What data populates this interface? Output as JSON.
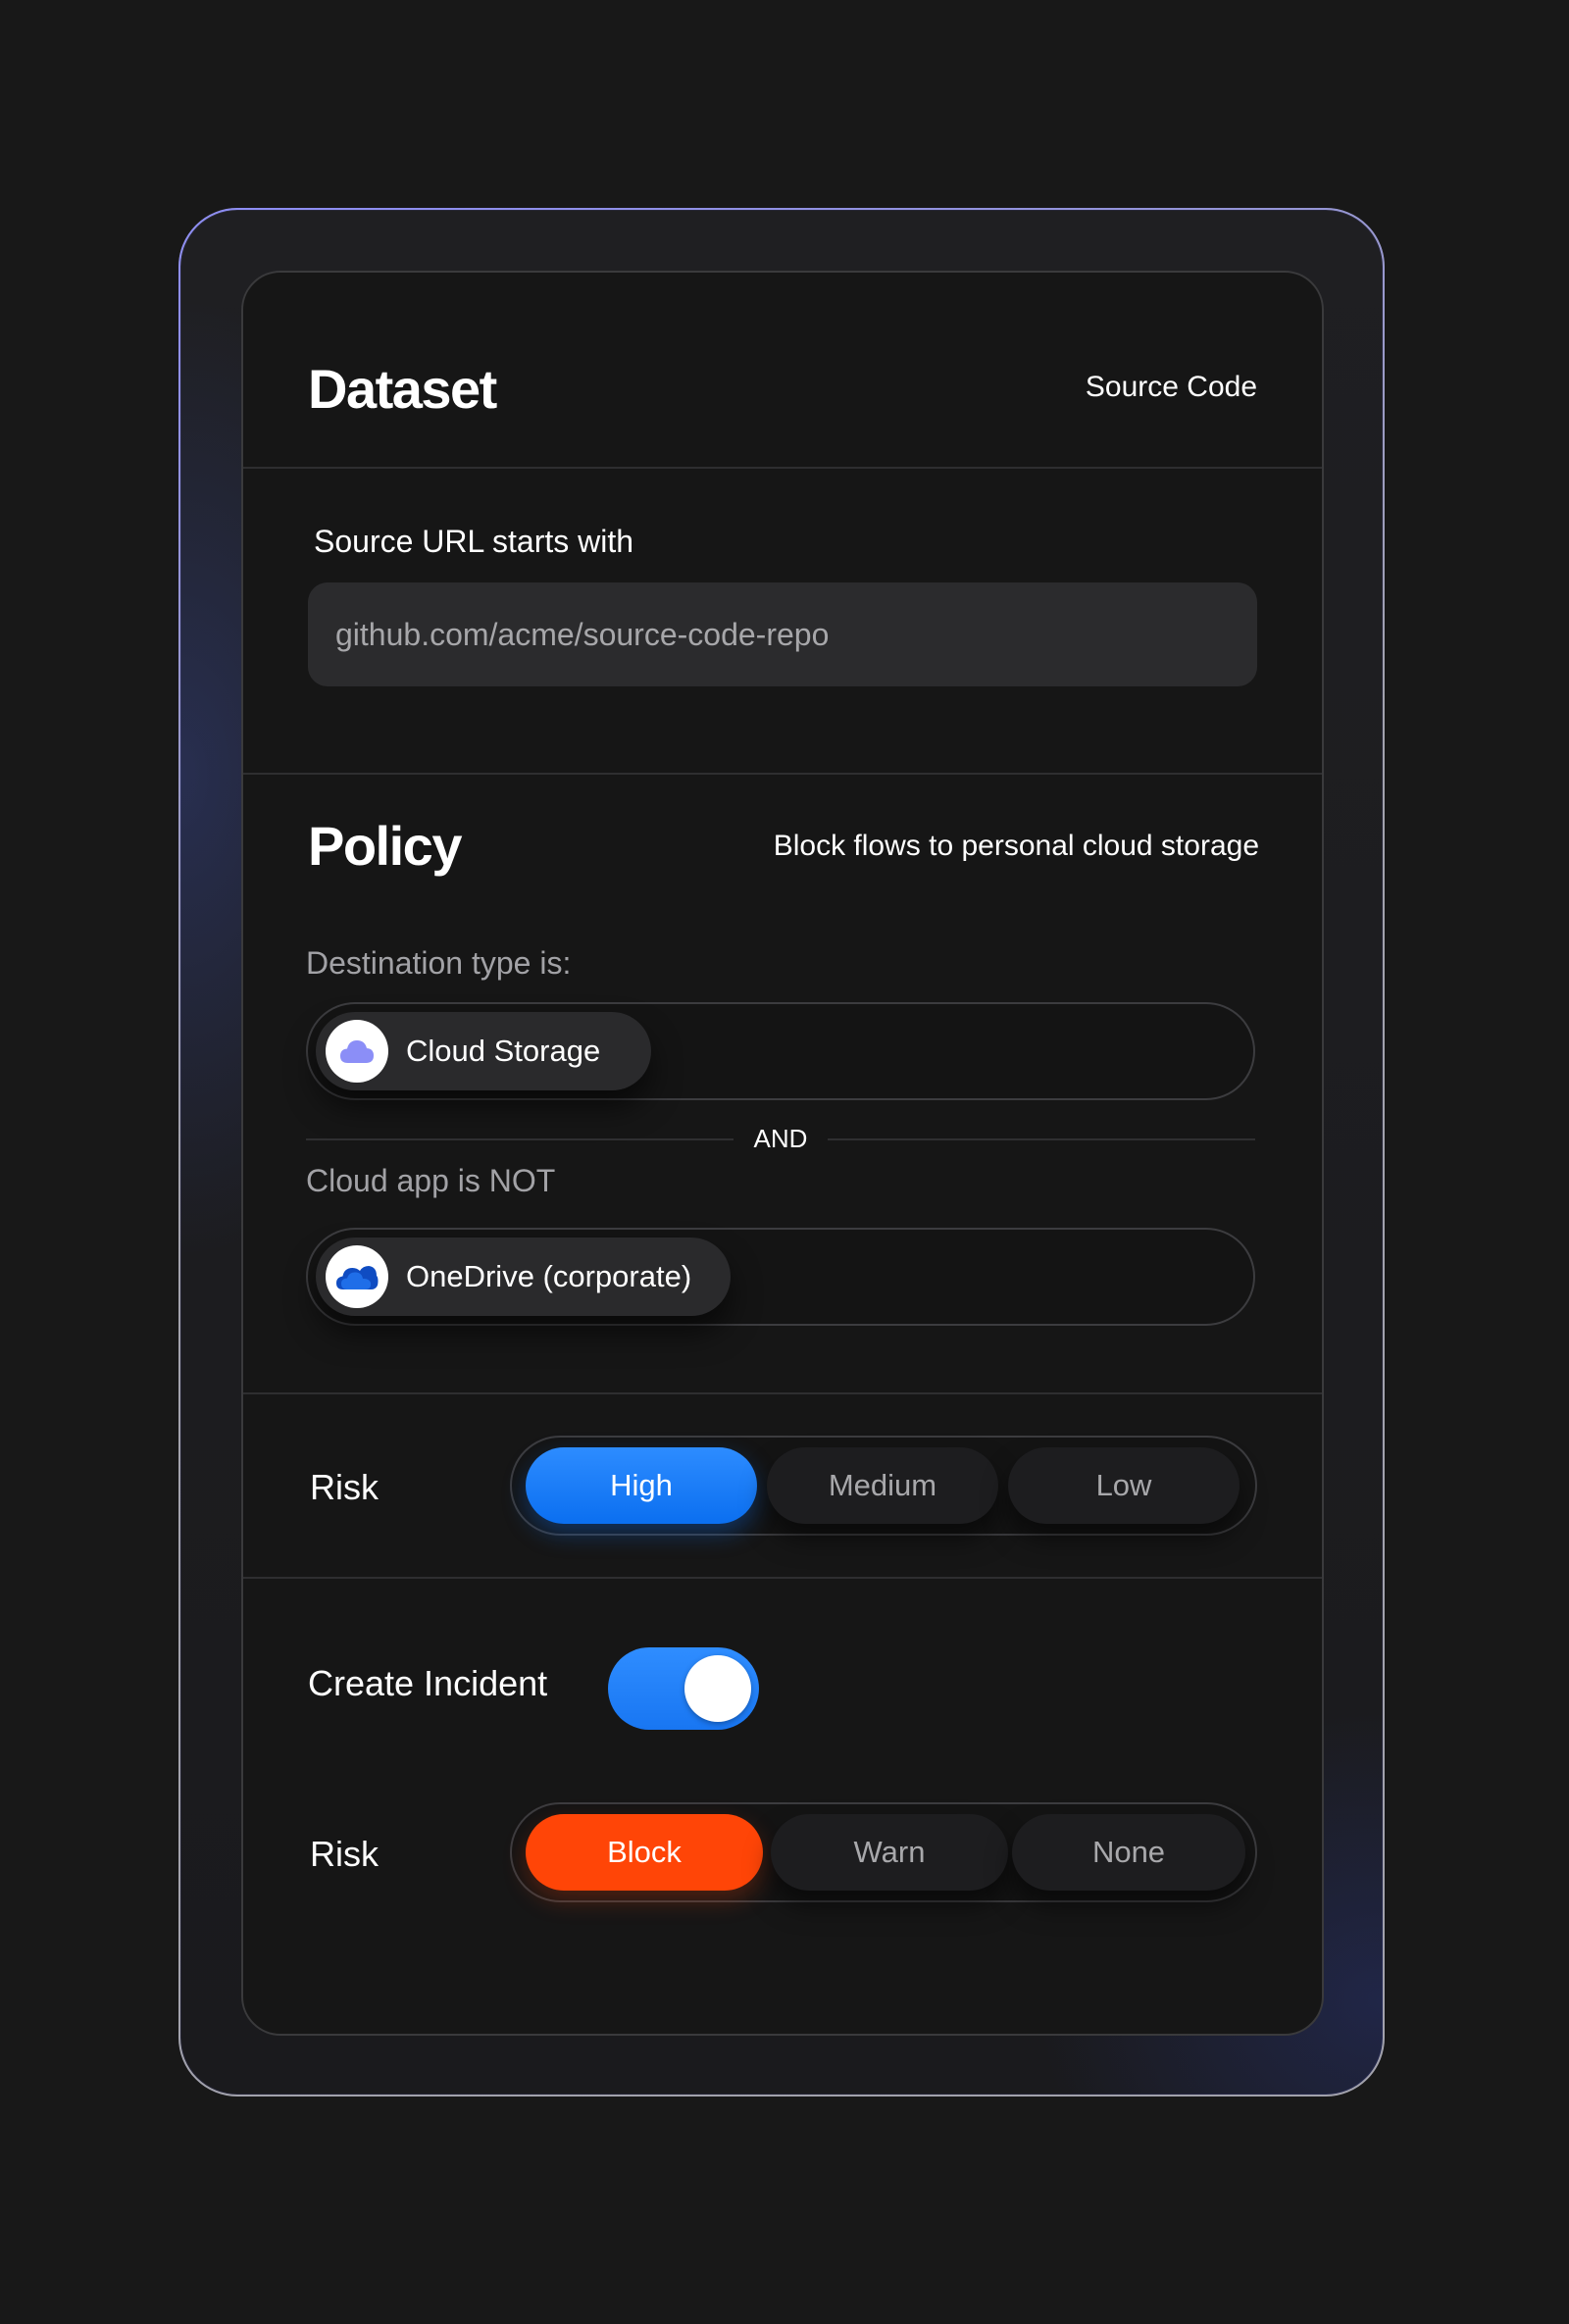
{
  "dataset": {
    "title": "Dataset",
    "value": "Source Code",
    "source_url_label": "Source URL starts with",
    "source_url_value": "github.com/acme/source-code-repo"
  },
  "policy": {
    "title": "Policy",
    "description": "Block flows to personal cloud storage",
    "destination_label": "Destination type is:",
    "destination_chip": {
      "label": "Cloud Storage",
      "icon": "cloud-icon",
      "icon_color": "#8b8ef7"
    },
    "and_label": "AND",
    "cloud_app_label": "Cloud app is NOT",
    "cloud_app_chip": {
      "label": "OneDrive (corporate)",
      "icon": "onedrive-icon",
      "icon_color": "#0f4cc2"
    }
  },
  "risk": {
    "label": "Risk",
    "options": [
      "High",
      "Medium",
      "Low"
    ],
    "selected": "High",
    "accent": "#1a7ff7"
  },
  "incident": {
    "label": "Create Incident",
    "enabled": true,
    "accent": "#2585fb"
  },
  "action": {
    "label": "Risk",
    "options": [
      "Block",
      "Warn",
      "None"
    ],
    "selected": "Block",
    "accent": "#ff4507"
  }
}
